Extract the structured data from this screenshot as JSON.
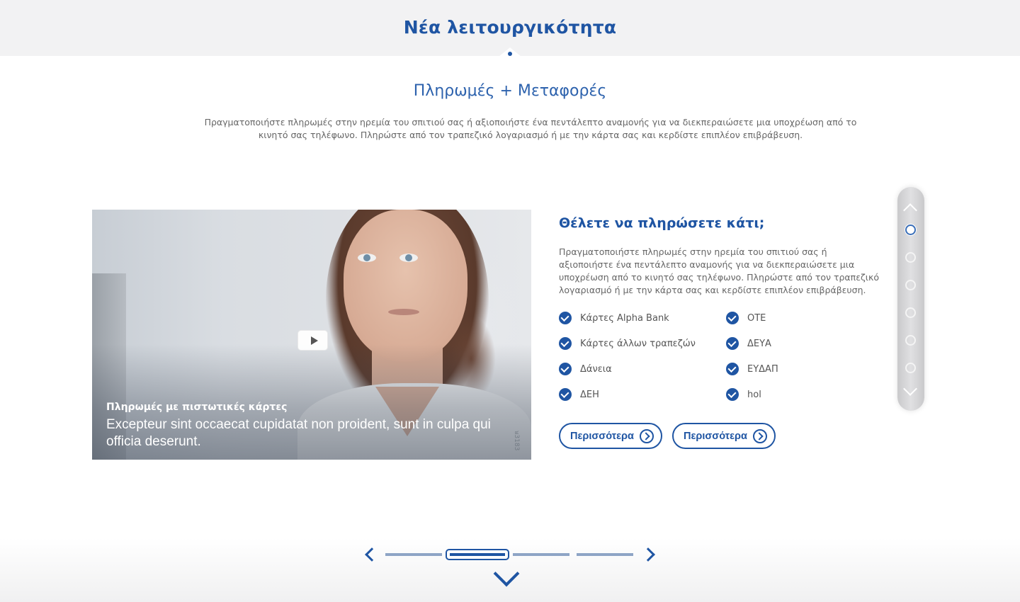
{
  "header": {
    "title": "Νέα λειτουργικότητα"
  },
  "intro": {
    "subtitle": "Πληρωμές + Μεταφορές",
    "text": "Πραγματοποιήστε πληρωμές στην ηρεμία του σπιτιού σας ή αξιοποιήστε ένα πεντάλεπτο αναμονής για να διεκπεραιώσετε μια υποχρέωση από το κινητό σας τηλέφωνο.  Πληρώστε από τον τραπεζικό λογαριασμό ή με την κάρτα σας και κερδίστε επιπλέον επιβράβευση."
  },
  "media": {
    "caption_title": "Πληρωμές με πιστωτικές κάρτες",
    "caption_text": "Excepteur sint occaecat cupidatat non proident, sunt in culpa qui officia deserunt.",
    "side_code": "ᴚ3183",
    "play_icon": "play-icon"
  },
  "section": {
    "heading": "Θέλετε να πληρώσετε κάτι;",
    "text": "Πραγματοποιήστε πληρωμές στην ηρεμία του σπιτιού σας ή αξιοποιήστε ένα πεντάλεπτο αναμονής για να διεκπεραιώσετε μια υποχρέωση από το κινητό σας τηλέφωνο.  Πληρώστε από τον τραπεζικό λογαριασμό ή με την κάρτα σας και κερδίστε επιπλέον επιβράβευση.",
    "checklist_left": [
      "Κάρτες Alpha Bank",
      "Κάρτες άλλων τραπεζών",
      "Δάνεια",
      "ΔΕΗ"
    ],
    "checklist_right": [
      "ΟΤΕ",
      "ΔΕΥΑ",
      "ΕΥΔΑΠ",
      "hol"
    ],
    "buttons": [
      {
        "label": "Περισσότερα"
      },
      {
        "label": "Περισσότερα"
      }
    ]
  },
  "rail": {
    "dots": 6,
    "active_index": 0
  },
  "pager": {
    "slides": 4,
    "active_index": 1
  },
  "colors": {
    "brand": "#1f55a3",
    "header_bg": "#f2f2f3",
    "pager_inactive": "#8ea5c6"
  }
}
